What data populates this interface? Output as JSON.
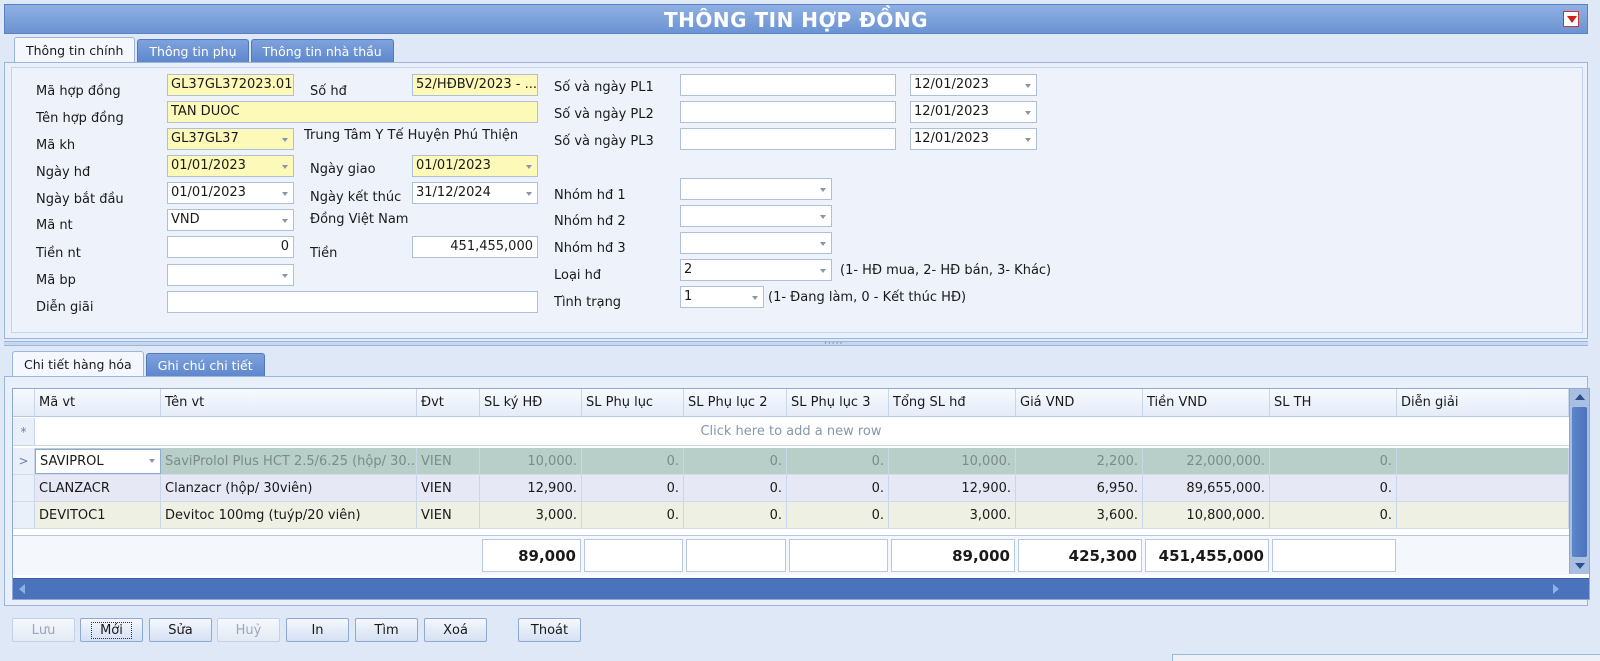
{
  "window": {
    "title": "THÔNG TIN HỢP ĐỒNG"
  },
  "top_tabs": [
    "Thông tin chính",
    "Thông tin phụ",
    "Thông tin nhà thầu"
  ],
  "form": {
    "ma_hop_dong": {
      "label": "Mã hợp đồng",
      "value": "GL37GL372023.01"
    },
    "so_hd": {
      "label": "Số hđ",
      "value": "52/HĐBV/2023 - ..."
    },
    "ten_hop_dong": {
      "label": "Tên hợp đồng",
      "value": "TAN DUOC"
    },
    "ma_kh": {
      "label": "Mã kh",
      "value": "GL37GL37",
      "desc": "Trung Tâm Y Tế Huyện Phú Thiện"
    },
    "ngay_hd": {
      "label": "Ngày hđ",
      "value": "01/01/2023"
    },
    "ngay_giao": {
      "label": "Ngày giao",
      "value": "01/01/2023"
    },
    "ngay_bat_dau": {
      "label": "Ngày bắt đầu",
      "value": "01/01/2023"
    },
    "ngay_ket_thuc": {
      "label": "Ngày kết thúc",
      "value": "31/12/2024"
    },
    "ma_nt": {
      "label": "Mã nt",
      "value": "VND",
      "desc": "Đồng Việt Nam"
    },
    "tien_nt": {
      "label": "Tiền nt",
      "value": "0"
    },
    "tien": {
      "label": "Tiền",
      "value": "451,455,000"
    },
    "ma_bp": {
      "label": "Mã bp",
      "value": ""
    },
    "dien_giai": {
      "label": "Diễn giãi",
      "value": ""
    },
    "pl": [
      {
        "label": "Số  và ngày PL1",
        "number": "",
        "date": "12/01/2023"
      },
      {
        "label": "Số  và ngày PL2",
        "number": "",
        "date": "12/01/2023"
      },
      {
        "label": "Số  và ngày PL3",
        "number": "",
        "date": "12/01/2023"
      }
    ],
    "nhom_hd": [
      {
        "label": "Nhóm hđ 1",
        "value": ""
      },
      {
        "label": "Nhóm hđ 2",
        "value": ""
      },
      {
        "label": "Nhóm hđ 3",
        "value": ""
      }
    ],
    "loai_hd": {
      "label": "Loại hđ",
      "value": "2",
      "hint": "(1- HĐ mua, 2- HĐ bán, 3- Khác)"
    },
    "tinh_trang": {
      "label": "Tình trạng",
      "value": "1",
      "hint": "(1- Đang làm, 0 - Kết thúc HĐ)"
    }
  },
  "detail_tabs": [
    "Chi tiết hàng hóa",
    "Ghi chú chi tiết"
  ],
  "grid": {
    "columns": [
      "Mã vt",
      "Tên vt",
      "Đvt",
      "SL ký HĐ",
      "SL Phụ lục",
      "SL Phụ lục 2",
      "SL Phụ lục 3",
      "Tổng SL hđ",
      "Giá VND",
      "Tiền VND",
      "SL TH",
      "Diễn giải"
    ],
    "new_row_text": "Click here to add a new row",
    "current_row_marker": ">",
    "new_row_marker": "*",
    "rows": [
      [
        "SAVIPROL",
        "SaviProlol Plus HCT 2.5/6.25 (hộp/ 30...",
        "VIEN",
        "10,000.",
        "0.",
        "0.",
        "0.",
        "10,000.",
        "2,200.",
        "22,000,000.",
        "0.",
        ""
      ],
      [
        "CLANZACR",
        "Clanzacr (hộp/ 30viên)",
        "VIEN",
        "12,900.",
        "0.",
        "0.",
        "0.",
        "12,900.",
        "6,950.",
        "89,655,000.",
        "0.",
        ""
      ],
      [
        "DEVITOC1",
        "Devitoc 100mg (tuýp/20 viên)",
        "VIEN",
        "3,000.",
        "0.",
        "0.",
        "0.",
        "3,000.",
        "3,600.",
        "10,800,000.",
        "0.",
        ""
      ]
    ],
    "totals": {
      "sl_ky_hd": "89,000",
      "tong_sl_hd": "89,000",
      "gia_vnd": "425,300",
      "tien_vnd": "451,455,000"
    }
  },
  "buttons": [
    "Lưu",
    "Mới",
    "Sửa",
    "Huỷ",
    "In",
    "Tìm",
    "Xoá",
    "Thoát"
  ],
  "colors": {
    "title_bar": "#6b93d3",
    "required_field": "#fdf9b8",
    "selected_row": "#b7cfc8",
    "alt_row": "#e7e8f6"
  }
}
